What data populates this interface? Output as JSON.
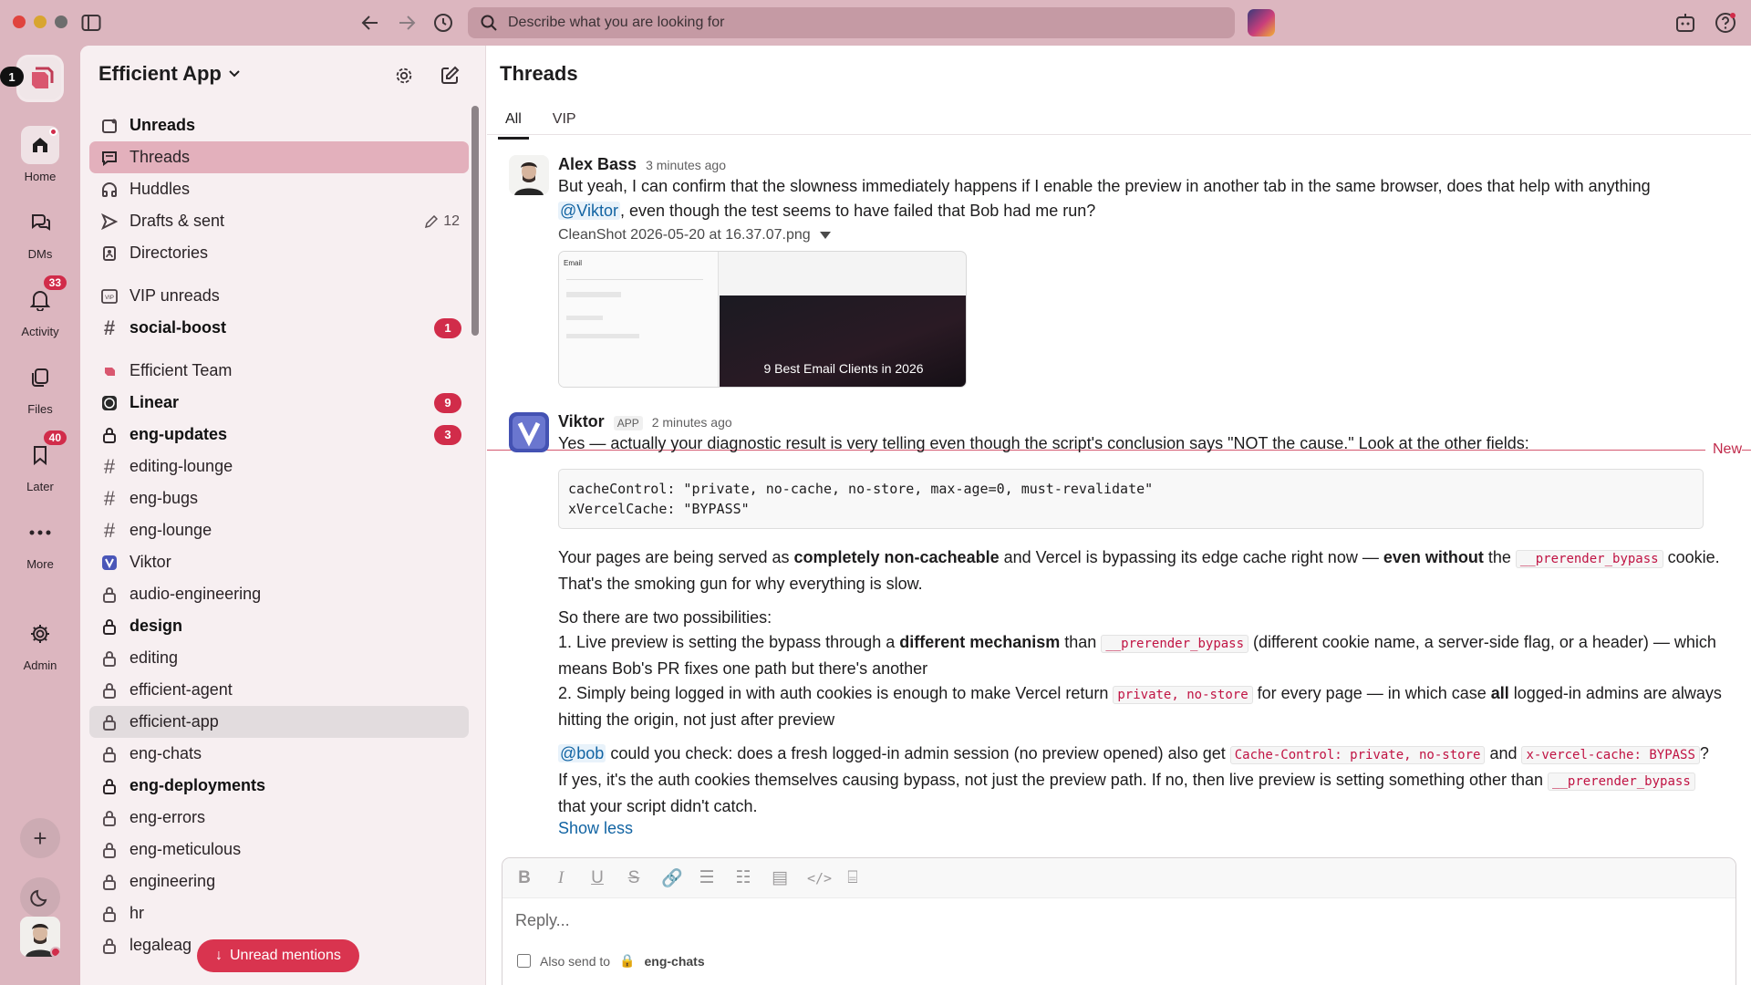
{
  "titlebar": {
    "search_placeholder": "Describe what you are looking for"
  },
  "rail": {
    "workspace_badge": "1",
    "items": [
      {
        "label": "Home",
        "icon": "home-icon"
      },
      {
        "label": "DMs",
        "icon": "dms-icon"
      },
      {
        "label": "Activity",
        "icon": "bell-icon",
        "badge": "33"
      },
      {
        "label": "Files",
        "icon": "files-icon"
      },
      {
        "label": "Later",
        "icon": "bookmark-icon",
        "badge": "40"
      },
      {
        "label": "More",
        "icon": "more-icon"
      },
      {
        "label": "Admin",
        "icon": "gear-icon"
      }
    ]
  },
  "sidebar": {
    "workspace_name": "Efficient App",
    "nav": [
      {
        "label": "Unreads"
      },
      {
        "label": "Threads"
      },
      {
        "label": "Huddles"
      },
      {
        "label": "Drafts & sent",
        "count": "12"
      },
      {
        "label": "Directories"
      }
    ],
    "vip_section": "VIP unreads",
    "vip_channels": [
      {
        "label": "social-boost",
        "badge": "1"
      }
    ],
    "team_section": "Efficient Team",
    "channels": [
      {
        "label": "Linear",
        "badge": "9"
      },
      {
        "label": "eng-updates",
        "badge": "3"
      },
      {
        "label": "editing-lounge"
      },
      {
        "label": "eng-bugs"
      },
      {
        "label": "eng-lounge"
      },
      {
        "label": "Viktor"
      },
      {
        "label": "audio-engineering"
      },
      {
        "label": "design"
      },
      {
        "label": "editing"
      },
      {
        "label": "efficient-agent"
      },
      {
        "label": "efficient-app"
      },
      {
        "label": "eng-chats"
      },
      {
        "label": "eng-deployments"
      },
      {
        "label": "eng-errors"
      },
      {
        "label": "eng-meticulous"
      },
      {
        "label": "engineering"
      },
      {
        "label": "hr"
      },
      {
        "label": "legaleag"
      }
    ],
    "unread_mentions": "Unread mentions"
  },
  "content": {
    "title": "Threads",
    "tabs": [
      "All",
      "VIP"
    ],
    "new_label": "New",
    "msg1": {
      "author": "Alex Bass",
      "time": "3 minutes ago",
      "text_a": "But yeah, I can confirm that the slowness immediately happens if I enable the preview in another tab in the same browser, does that help with anything",
      "mention": "@Viktor",
      "text_b": ", even though the test seems to have failed that Bob had me run?",
      "attachment": "CleanShot 2026-05-20 at 16.37.07.png",
      "preview_caption": "9 Best Email Clients in 2026",
      "preview_label": "Email"
    },
    "msg2": {
      "author": "Viktor",
      "tag": "APP",
      "time": "2 minutes ago",
      "intro": "Yes — actually your diagnostic result is very telling even though the script's conclusion says \"NOT the cause.\" Look at the other fields:",
      "code_1": "cacheControl: \"private, no-cache, no-store, max-age=0, must-revalidate\"",
      "code_2": "xVercelCache: \"BYPASS\"",
      "p1_a": "Your pages are being served as ",
      "p1_b": "completely non-cacheable",
      "p1_c": " and Vercel is bypassing its edge cache right now — ",
      "p1_d": "even without",
      "p1_e": " the ",
      "p1_code": "__prerender_bypass",
      "p1_f": " cookie. That's the smoking gun for why everything is slow.",
      "p2": "So there are two possibilities:",
      "li1_a": "1. Live preview is setting the bypass through a ",
      "li1_b": "different mechanism",
      "li1_c": " than ",
      "li1_code": "__prerender_bypass",
      "li1_d": " (different cookie name, a server-side flag, or a header) — which means Bob's PR fixes one path but there's another",
      "li2_a": "2. Simply being logged in with auth cookies is enough to make Vercel return ",
      "li2_code": "private, no-store",
      "li2_b": " for every page — in which case ",
      "li2_c": "all",
      "li2_d": " logged-in admins are always hitting the origin, not just after preview",
      "p3_mention": "@bob",
      "p3_a": " could you check: does a fresh logged-in admin session (no preview opened) also get ",
      "p3_code1": "Cache-Control: private, no-store",
      "p3_b": " and ",
      "p3_code2": "x-vercel-cache: BYPASS",
      "p3_c": "? If yes, it's the auth cookies themselves causing bypass, not just the preview path. If no, then live preview is setting something other than ",
      "p3_code3": "__prerender_bypass",
      "p3_d": " that your script didn't catch.",
      "show_less": "Show less"
    },
    "composer": {
      "placeholder": "Reply...",
      "also_send": "Also send to",
      "channel": "eng-chats"
    }
  }
}
